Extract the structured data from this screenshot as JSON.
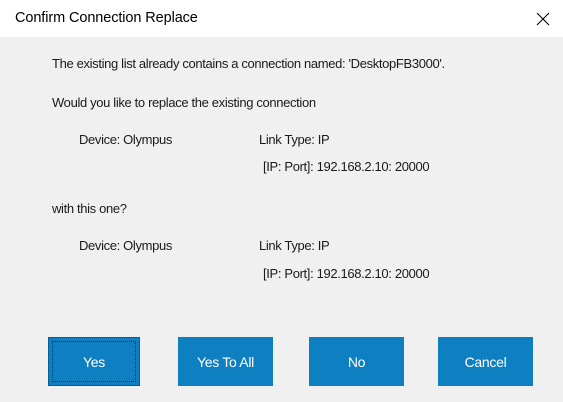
{
  "dialog": {
    "title": "Confirm Connection Replace",
    "close_glyph": "✕"
  },
  "message": {
    "line1": "The existing list already contains a connection named: 'DesktopFB3000'.",
    "line2": "Would you like to replace the existing connection",
    "line3": "with this one?"
  },
  "existing": {
    "device": "Device: Olympus",
    "link_type": "Link Type: IP",
    "ip_port": "[IP: Port]: 192.168.2.10: 20000"
  },
  "replacement": {
    "device": "Device: Olympus",
    "link_type": "Link Type: IP",
    "ip_port": "[IP: Port]: 192.168.2.10: 20000"
  },
  "buttons": {
    "yes": "Yes",
    "yes_to_all": "Yes To All",
    "no": "No",
    "cancel": "Cancel"
  },
  "colors": {
    "button_bg": "#0e7fc0",
    "dialog_bg": "#f0f0f0",
    "titlebar_bg": "#ffffff"
  }
}
